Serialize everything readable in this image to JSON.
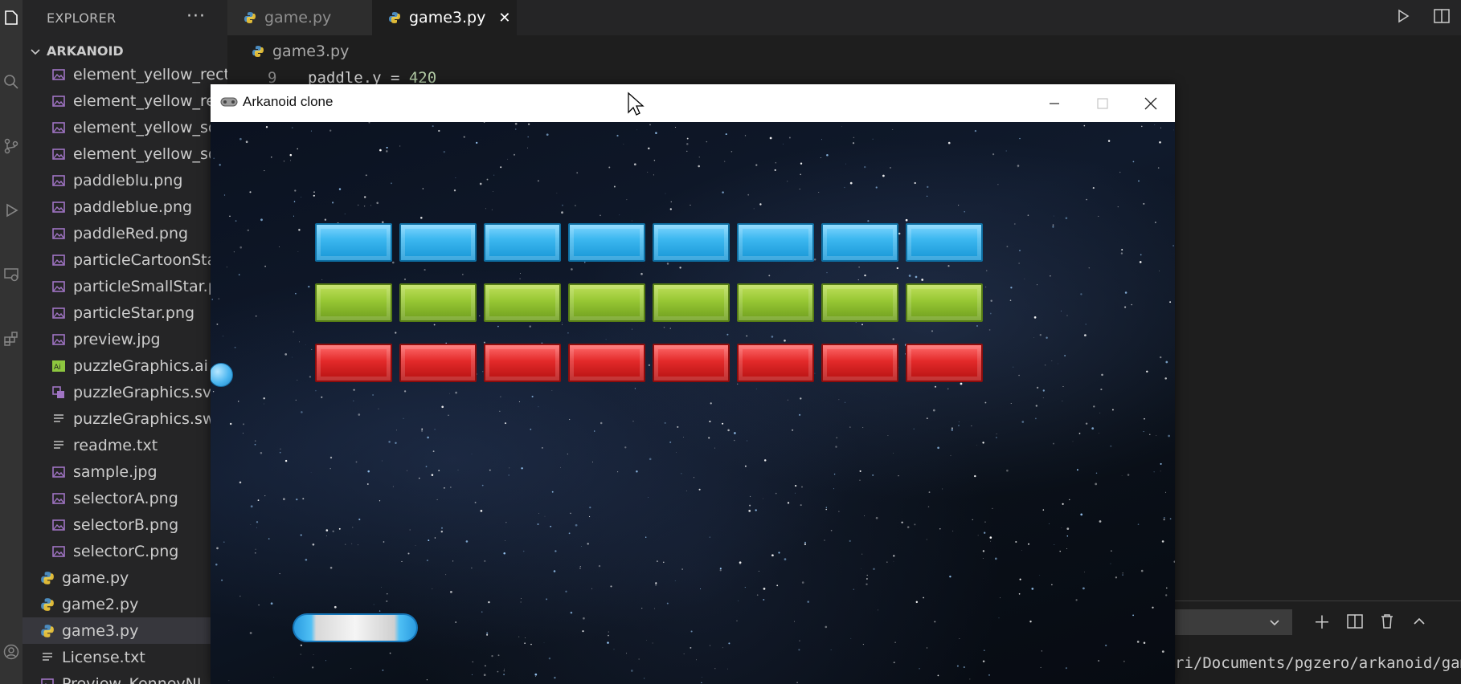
{
  "sidebar": {
    "header": "EXPLORER",
    "section": "ARKANOID",
    "files": [
      {
        "name": "element_yellow_rect...",
        "type": "image"
      },
      {
        "name": "element_yellow_rect",
        "type": "image"
      },
      {
        "name": "element_yellow_squ",
        "type": "image"
      },
      {
        "name": "element_yellow_squ",
        "type": "image"
      },
      {
        "name": "paddleblu.png",
        "type": "image"
      },
      {
        "name": "paddleblue.png",
        "type": "image"
      },
      {
        "name": "paddleRed.png",
        "type": "image"
      },
      {
        "name": "particleCartoonStar.",
        "type": "image"
      },
      {
        "name": "particleSmallStar.pn",
        "type": "image"
      },
      {
        "name": "particleStar.png",
        "type": "image"
      },
      {
        "name": "preview.jpg",
        "type": "image"
      },
      {
        "name": "puzzleGraphics.ai",
        "type": "ai"
      },
      {
        "name": "puzzleGraphics.svg",
        "type": "svg"
      },
      {
        "name": "puzzleGraphics.swf",
        "type": "text"
      },
      {
        "name": "readme.txt",
        "type": "text"
      },
      {
        "name": "sample.jpg",
        "type": "image"
      },
      {
        "name": "selectorA.png",
        "type": "image"
      },
      {
        "name": "selectorB.png",
        "type": "image"
      },
      {
        "name": "selectorC.png",
        "type": "image"
      },
      {
        "name": "game.py",
        "type": "python"
      },
      {
        "name": "game2.py",
        "type": "python"
      },
      {
        "name": "game3.py",
        "type": "python",
        "active": true
      },
      {
        "name": "License.txt",
        "type": "text"
      },
      {
        "name": "Preview_KenneyNL.pn",
        "type": "image"
      }
    ]
  },
  "tabs": [
    {
      "label": "game.py",
      "active": false
    },
    {
      "label": "game3.py",
      "active": true
    }
  ],
  "breadcrumb": "game3.py",
  "editor": {
    "line_number": "9",
    "code_prefix": "paddle.y = ",
    "code_value": "420"
  },
  "terminal": {
    "path": "ri/Documents/pgzero/arkanoid/game"
  },
  "game_window": {
    "title": "Arkanoid clone",
    "brick_rows": [
      "blue",
      "green",
      "red"
    ],
    "bricks_per_row": 8
  },
  "colors": {
    "brick_blue": "#3db8f0",
    "brick_green": "#97c734",
    "brick_red": "#e32a2a",
    "vscode_bg": "#1e1e1e"
  }
}
